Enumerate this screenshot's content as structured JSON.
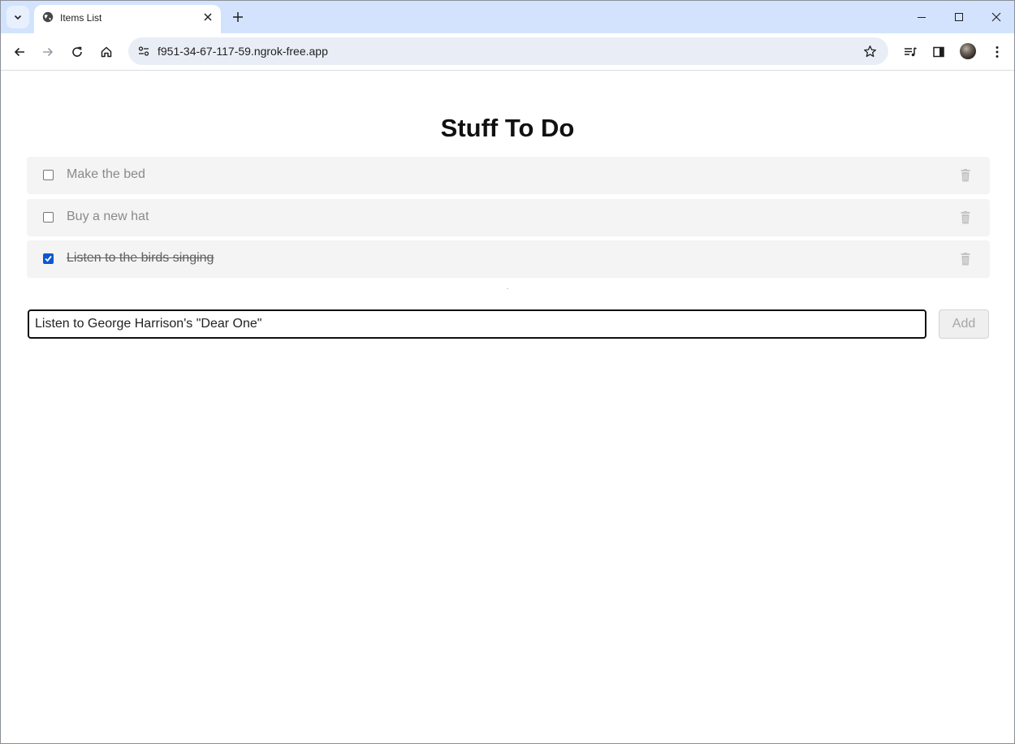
{
  "browser": {
    "tab_title": "Items List",
    "url": "f951-34-67-117-59.ngrok-free.app"
  },
  "icons": {
    "tab_search": "chevron-down-icon",
    "favicon": "globe-icon",
    "tab_close": "close-icon",
    "new_tab": "plus-icon",
    "minimize": "minimize-icon",
    "maximize": "maximize-icon",
    "close_window": "close-icon",
    "back": "arrow-left-icon",
    "forward": "arrow-right-icon",
    "reload": "reload-icon",
    "home": "home-icon",
    "site_info": "tune-icon",
    "bookmark": "star-icon",
    "media": "media-queue-icon",
    "side_panel": "side-panel-icon",
    "menu": "kebab-menu-icon",
    "delete": "trash-icon"
  },
  "colors": {
    "tab_strip": "#d3e3fd",
    "omnibox": "#e9eef6",
    "item_bg": "#f4f4f4",
    "checkbox_checked": "#0b57d0"
  },
  "page": {
    "title": "Stuff To Do",
    "items": [
      {
        "label": "Make the bed",
        "done": false
      },
      {
        "label": "Buy a new hat",
        "done": false
      },
      {
        "label": "Listen to the birds singing",
        "done": true
      }
    ],
    "new_item_value": "Listen to George Harrison's \"Dear One\"",
    "add_label": "Add"
  }
}
